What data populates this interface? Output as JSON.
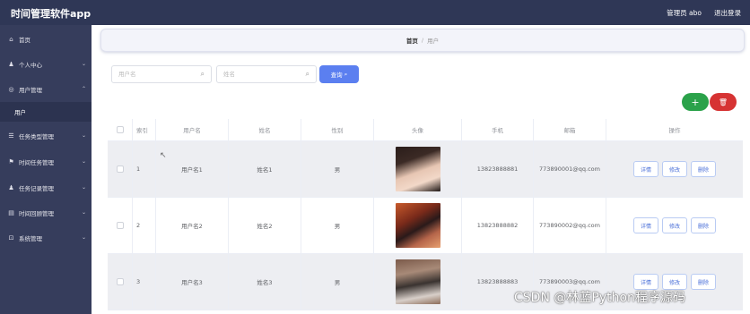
{
  "header": {
    "title": "时间管理软件app",
    "user_label": "管理员 abo",
    "logout": "退出登录"
  },
  "sidebar": {
    "items": [
      {
        "label": "首页",
        "icon": "home-icon",
        "glyph": "⌂"
      },
      {
        "label": "个人中心",
        "icon": "user-icon",
        "glyph": "♟"
      },
      {
        "label": "用户管理",
        "icon": "users-icon",
        "glyph": "◎"
      },
      {
        "label": "任务类型管理",
        "icon": "list-icon",
        "glyph": "☰"
      },
      {
        "label": "时间任务管理",
        "icon": "flag-icon",
        "glyph": "⚑"
      },
      {
        "label": "任务记录管理",
        "icon": "record-icon",
        "glyph": "♟"
      },
      {
        "label": "时间回顾管理",
        "icon": "review-icon",
        "glyph": "▤"
      },
      {
        "label": "系统管理",
        "icon": "settings-icon",
        "glyph": "⊡"
      }
    ],
    "sub_item": "用户"
  },
  "breadcrumb": {
    "home": "首页",
    "sep": "/",
    "current": "用户"
  },
  "search": {
    "username_placeholder": "用户名",
    "name_placeholder": "姓名",
    "query_label": "查询"
  },
  "actions": {
    "add": "+",
    "delete": "🗑"
  },
  "table": {
    "headers": [
      "索引",
      "用户名",
      "姓名",
      "性别",
      "头像",
      "手机",
      "邮箱",
      "操作"
    ],
    "rows": [
      {
        "index": "1",
        "username": "用户名1",
        "name": "姓名1",
        "gender": "男",
        "phone": "13823888881",
        "email": "773890001@qq.com"
      },
      {
        "index": "2",
        "username": "用户名2",
        "name": "姓名2",
        "gender": "男",
        "phone": "13823888882",
        "email": "773890002@qq.com"
      },
      {
        "index": "3",
        "username": "用户名3",
        "name": "姓名3",
        "gender": "男",
        "phone": "13823888883",
        "email": "773890003@qq.com"
      }
    ],
    "op_labels": {
      "detail": "详情",
      "edit": "修改",
      "delete": "删除"
    }
  },
  "watermark": "CSDN @林蓝Python程序源码",
  "colors": {
    "topbar": "#2f3756",
    "sidebar": "#363d5c",
    "primary": "#5b7ff0",
    "success": "#2ba24a",
    "danger": "#d63333"
  }
}
